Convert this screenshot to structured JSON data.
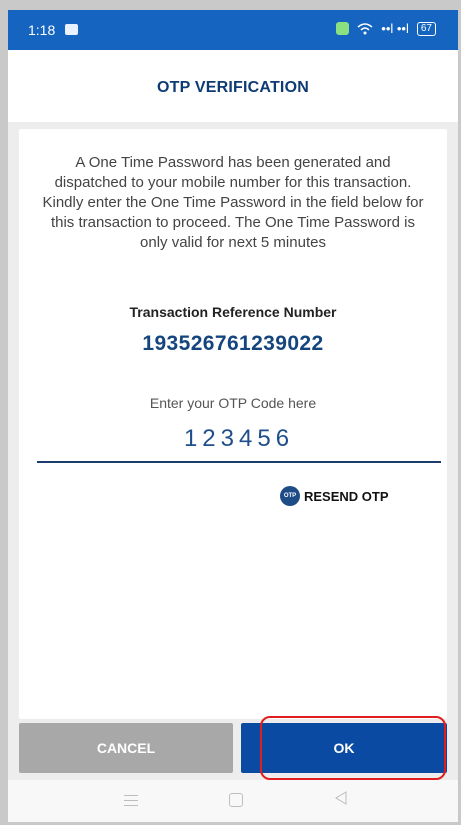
{
  "status_bar": {
    "time": "1:18",
    "signal_text": "••l ••l",
    "battery": "67"
  },
  "header": {
    "title": "OTP VERIFICATION"
  },
  "message": "A One Time Password has been generated and dispatched to your mobile number for this transaction. Kindly enter the One Time Password in the field below for this transaction to proceed. The One Time Password  is only valid for next 5 minutes",
  "reference": {
    "label": "Transaction Reference Number",
    "number": "193526761239022"
  },
  "otp": {
    "prompt": "Enter your OTP Code here",
    "value": "123456"
  },
  "resend": {
    "icon_text": "OTP",
    "label": "RESEND OTP"
  },
  "actions": {
    "cancel_label": "CANCEL",
    "ok_label": "OK"
  },
  "colors": {
    "status_bar": "#1565c0",
    "title": "#0e3b73",
    "ok_button": "#0b4aa2",
    "cancel_button": "#a8a8a8",
    "highlight": "#e01e1e"
  }
}
